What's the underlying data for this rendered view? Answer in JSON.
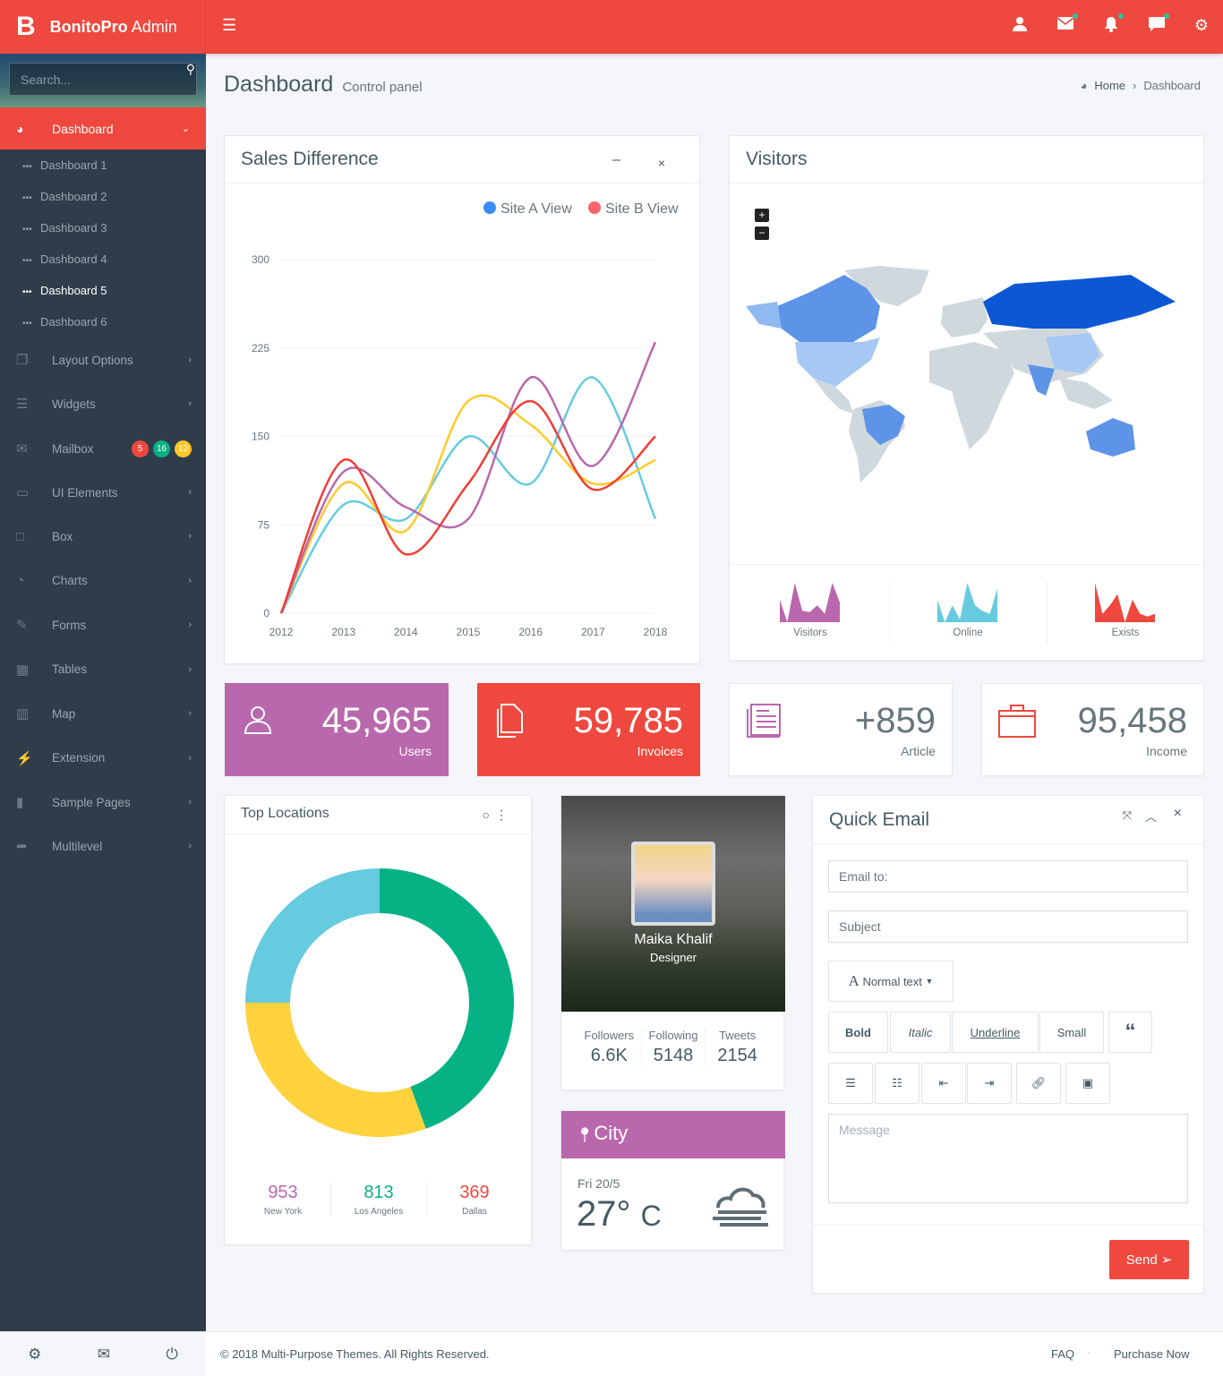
{
  "brand": {
    "logo_letter": "B",
    "name_bold": "BonitoPro",
    "name_light": "Admin"
  },
  "header": {
    "icons": [
      "user-icon",
      "mail-icon",
      "bell-icon",
      "chat-icon",
      "gear-icon"
    ]
  },
  "sidebar": {
    "search_placeholder": "Search...",
    "active": "Dashboard",
    "sub_items": [
      "Dashboard 1",
      "Dashboard 2",
      "Dashboard 3",
      "Dashboard 4",
      "Dashboard 5",
      "Dashboard 6"
    ],
    "selected_sub": "Dashboard 5",
    "items": [
      {
        "label": "Layout Options",
        "icon": "copy-icon"
      },
      {
        "label": "Widgets",
        "icon": "list-icon"
      },
      {
        "label": "Mailbox",
        "icon": "mail-icon",
        "badges": [
          {
            "text": "5",
            "color": "#ef483e"
          },
          {
            "text": "16",
            "color": "#06b183"
          },
          {
            "text": "12",
            "color": "#ffc928"
          }
        ]
      },
      {
        "label": "UI Elements",
        "icon": "laptop-icon"
      },
      {
        "label": "Box",
        "icon": "square-icon"
      },
      {
        "label": "Charts",
        "icon": "pie-chart-icon"
      },
      {
        "label": "Forms",
        "icon": "edit-icon"
      },
      {
        "label": "Tables",
        "icon": "table-icon"
      },
      {
        "label": "Map",
        "icon": "map-icon"
      },
      {
        "label": "Extension",
        "icon": "plug-icon"
      },
      {
        "label": "Sample Pages",
        "icon": "file-icon"
      },
      {
        "label": "Multilevel",
        "icon": "share-icon"
      }
    ]
  },
  "page": {
    "title": "Dashboard",
    "subtitle": "Control panel",
    "breadcrumb": [
      "Home",
      "Dashboard"
    ]
  },
  "sales": {
    "title": "Sales Difference"
  },
  "chart_data": {
    "type": "line",
    "categories": [
      "2012",
      "2013",
      "2014",
      "2015",
      "2016",
      "2017",
      "2018"
    ],
    "ylim": [
      0,
      300
    ],
    "yticks": [
      "0",
      "75",
      "150",
      "225",
      "300"
    ],
    "legend": [
      {
        "name": "Site A View",
        "color": "#398bf7"
      },
      {
        "name": "Site B View",
        "color": "#f8646a"
      }
    ],
    "legend_position": "top-right",
    "grid": true,
    "series": [
      {
        "color": "#67cbe0",
        "values": [
          0,
          92,
          80,
          150,
          110,
          200,
          80
        ]
      },
      {
        "color": "#ffca2c",
        "values": [
          0,
          110,
          70,
          180,
          160,
          110,
          130
        ]
      },
      {
        "color": "#b968ad",
        "values": [
          0,
          120,
          90,
          80,
          200,
          125,
          230
        ]
      },
      {
        "color": "#ef3e36",
        "values": [
          0,
          130,
          50,
          110,
          180,
          105,
          150
        ]
      }
    ]
  },
  "visitors": {
    "title": "Visitors",
    "zoom_in": "+",
    "zoom_out": "−",
    "sparks": [
      {
        "label": "Visitors",
        "color": "#b968ad",
        "values": [
          4,
          0,
          7,
          2,
          1.8,
          3,
          1.5,
          7,
          3.5
        ]
      },
      {
        "label": "Online",
        "color": "#67cbe0",
        "values": [
          4,
          0,
          3,
          0.5,
          7,
          3,
          2,
          1.5,
          6
        ]
      },
      {
        "label": "Exists",
        "color": "#ef483e",
        "values": [
          7,
          1.5,
          3,
          5,
          0,
          4,
          1.5,
          1,
          1.5
        ]
      }
    ]
  },
  "stats": [
    {
      "value": "45,965",
      "label": "Users",
      "color": "#b968ad",
      "icon": "user-icon"
    },
    {
      "value": "59,785",
      "label": "Invoices",
      "color": "#ef483e",
      "icon": "document-icon"
    },
    {
      "value": "+859",
      "label": "Article",
      "color": "#b968ad",
      "icon": "newspaper-icon"
    },
    {
      "value": "95,458",
      "label": "Income",
      "color": "#ef483e",
      "icon": "briefcase-icon"
    }
  ],
  "locations": {
    "title": "Top Locations",
    "donut": [
      {
        "fraction": 0.444,
        "color": "#06b183"
      },
      {
        "fraction": 0.306,
        "color": "#ffd23e"
      },
      {
        "fraction": 0.25,
        "color": "#67cbe0"
      }
    ],
    "items": [
      {
        "value": "953",
        "label": "New York",
        "color": "#b968ad"
      },
      {
        "value": "813",
        "label": "Los Angeles",
        "color": "#06b183"
      },
      {
        "value": "369",
        "label": "Dallas",
        "color": "#ef483e"
      }
    ]
  },
  "profile": {
    "name": "Maika Khalif",
    "role": "Designer",
    "stats": [
      {
        "label": "Followers",
        "value": "6.6K"
      },
      {
        "label": "Following",
        "value": "5148"
      },
      {
        "label": "Tweets",
        "value": "2154"
      }
    ]
  },
  "weather": {
    "city": "City",
    "date": "Fri 20/5",
    "temp": "27°",
    "unit": "C",
    "icon": "fog-cloud-icon"
  },
  "email": {
    "title": "Quick Email",
    "to_placeholder": "Email to:",
    "subject_placeholder": "Subject",
    "style_select": "Normal text",
    "format_buttons": [
      "Bold",
      "Italic",
      "Underline",
      "Small"
    ],
    "message_placeholder": "Message",
    "send": "Send"
  },
  "footer": {
    "copyright": "© 2018 Multi-Purpose Themes. All Rights Reserved.",
    "links": [
      "FAQ",
      "Purchase Now"
    ]
  }
}
